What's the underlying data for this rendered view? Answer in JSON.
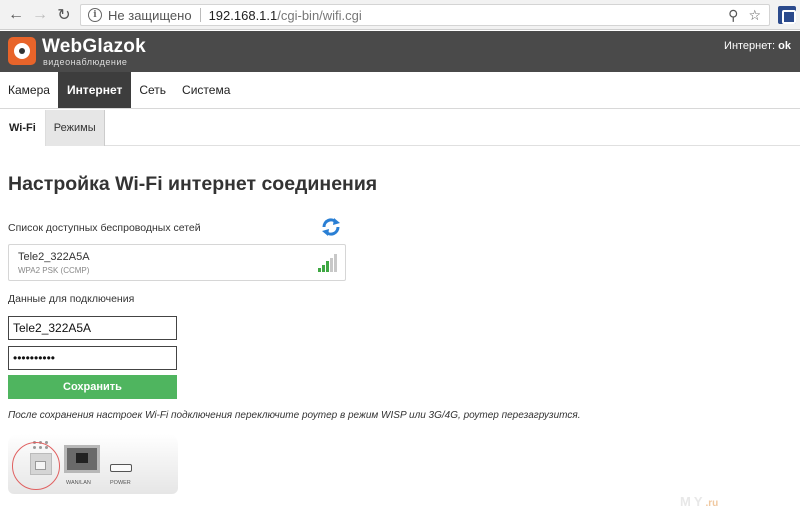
{
  "browser": {
    "insecure_label": "Не защищено",
    "url_host": "192.168.1.1",
    "url_path": "/cgi-bin/wifi.cgi",
    "icons": [
      "back-arrow-icon",
      "forward-arrow-icon",
      "reload-icon",
      "info-icon",
      "key-icon",
      "star-icon",
      "extension-icon"
    ]
  },
  "header": {
    "logo_title": "WebGlazok",
    "logo_subtitle": "видеонаблюдение",
    "status_label": "Интернет:",
    "status_value": "ok"
  },
  "main_nav": {
    "items": [
      {
        "label": "Камера",
        "active": false
      },
      {
        "label": "Интернет",
        "active": true
      },
      {
        "label": "Сеть",
        "active": false
      },
      {
        "label": "Система",
        "active": false
      }
    ]
  },
  "sub_tabs": {
    "items": [
      {
        "label": "Wi-Fi",
        "active": true
      },
      {
        "label": "Режимы",
        "active": false
      }
    ]
  },
  "content": {
    "title": "Настройка Wi-Fi интернет соединения",
    "networks_label": "Список доступных беспроводных сетей",
    "network": {
      "ssid": "Tele2_322A5A",
      "security": "WPA2 PSK (CCMP)",
      "signal_bars_active": 3,
      "signal_bars_total": 5
    },
    "connection_label": "Данные для подключения",
    "ssid_value": "Tele2_322A5A",
    "password_value": "••••••••••",
    "save_label": "Сохранить",
    "note": "После сохранения настроек Wi-Fi подключения переключите роутер в режим WISP или 3G/4G, роутер перезагрузится."
  },
  "router_image": {
    "port_label": "WAN/LAN",
    "power_label": "POWER"
  },
  "watermark": {
    "text": "MY",
    "suffix": ".ru"
  },
  "colors": {
    "header_bg": "#4a4a4a",
    "logo_orange": "#e8642a",
    "nav_active_bg": "#3d3d3d",
    "save_green": "#4fb55f",
    "signal_green": "#3ea843",
    "refresh_blue": "#2a7fd4"
  }
}
